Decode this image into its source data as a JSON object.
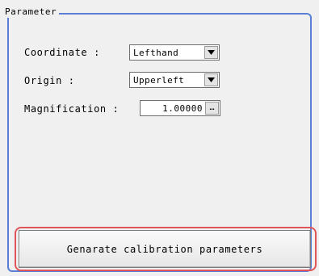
{
  "group": {
    "title": "Parameter"
  },
  "fields": {
    "coordinate": {
      "label": "Coordinate :",
      "value": "Lefthand"
    },
    "origin": {
      "label": "Origin :",
      "value": "Upperleft"
    },
    "magnification": {
      "label": "Magnification :",
      "value": "1.00000",
      "button": "…"
    }
  },
  "actions": {
    "generate_label": "Genarate calibration parameters"
  },
  "colors": {
    "frame": "#5b7fd6",
    "highlight": "#e0555a"
  }
}
